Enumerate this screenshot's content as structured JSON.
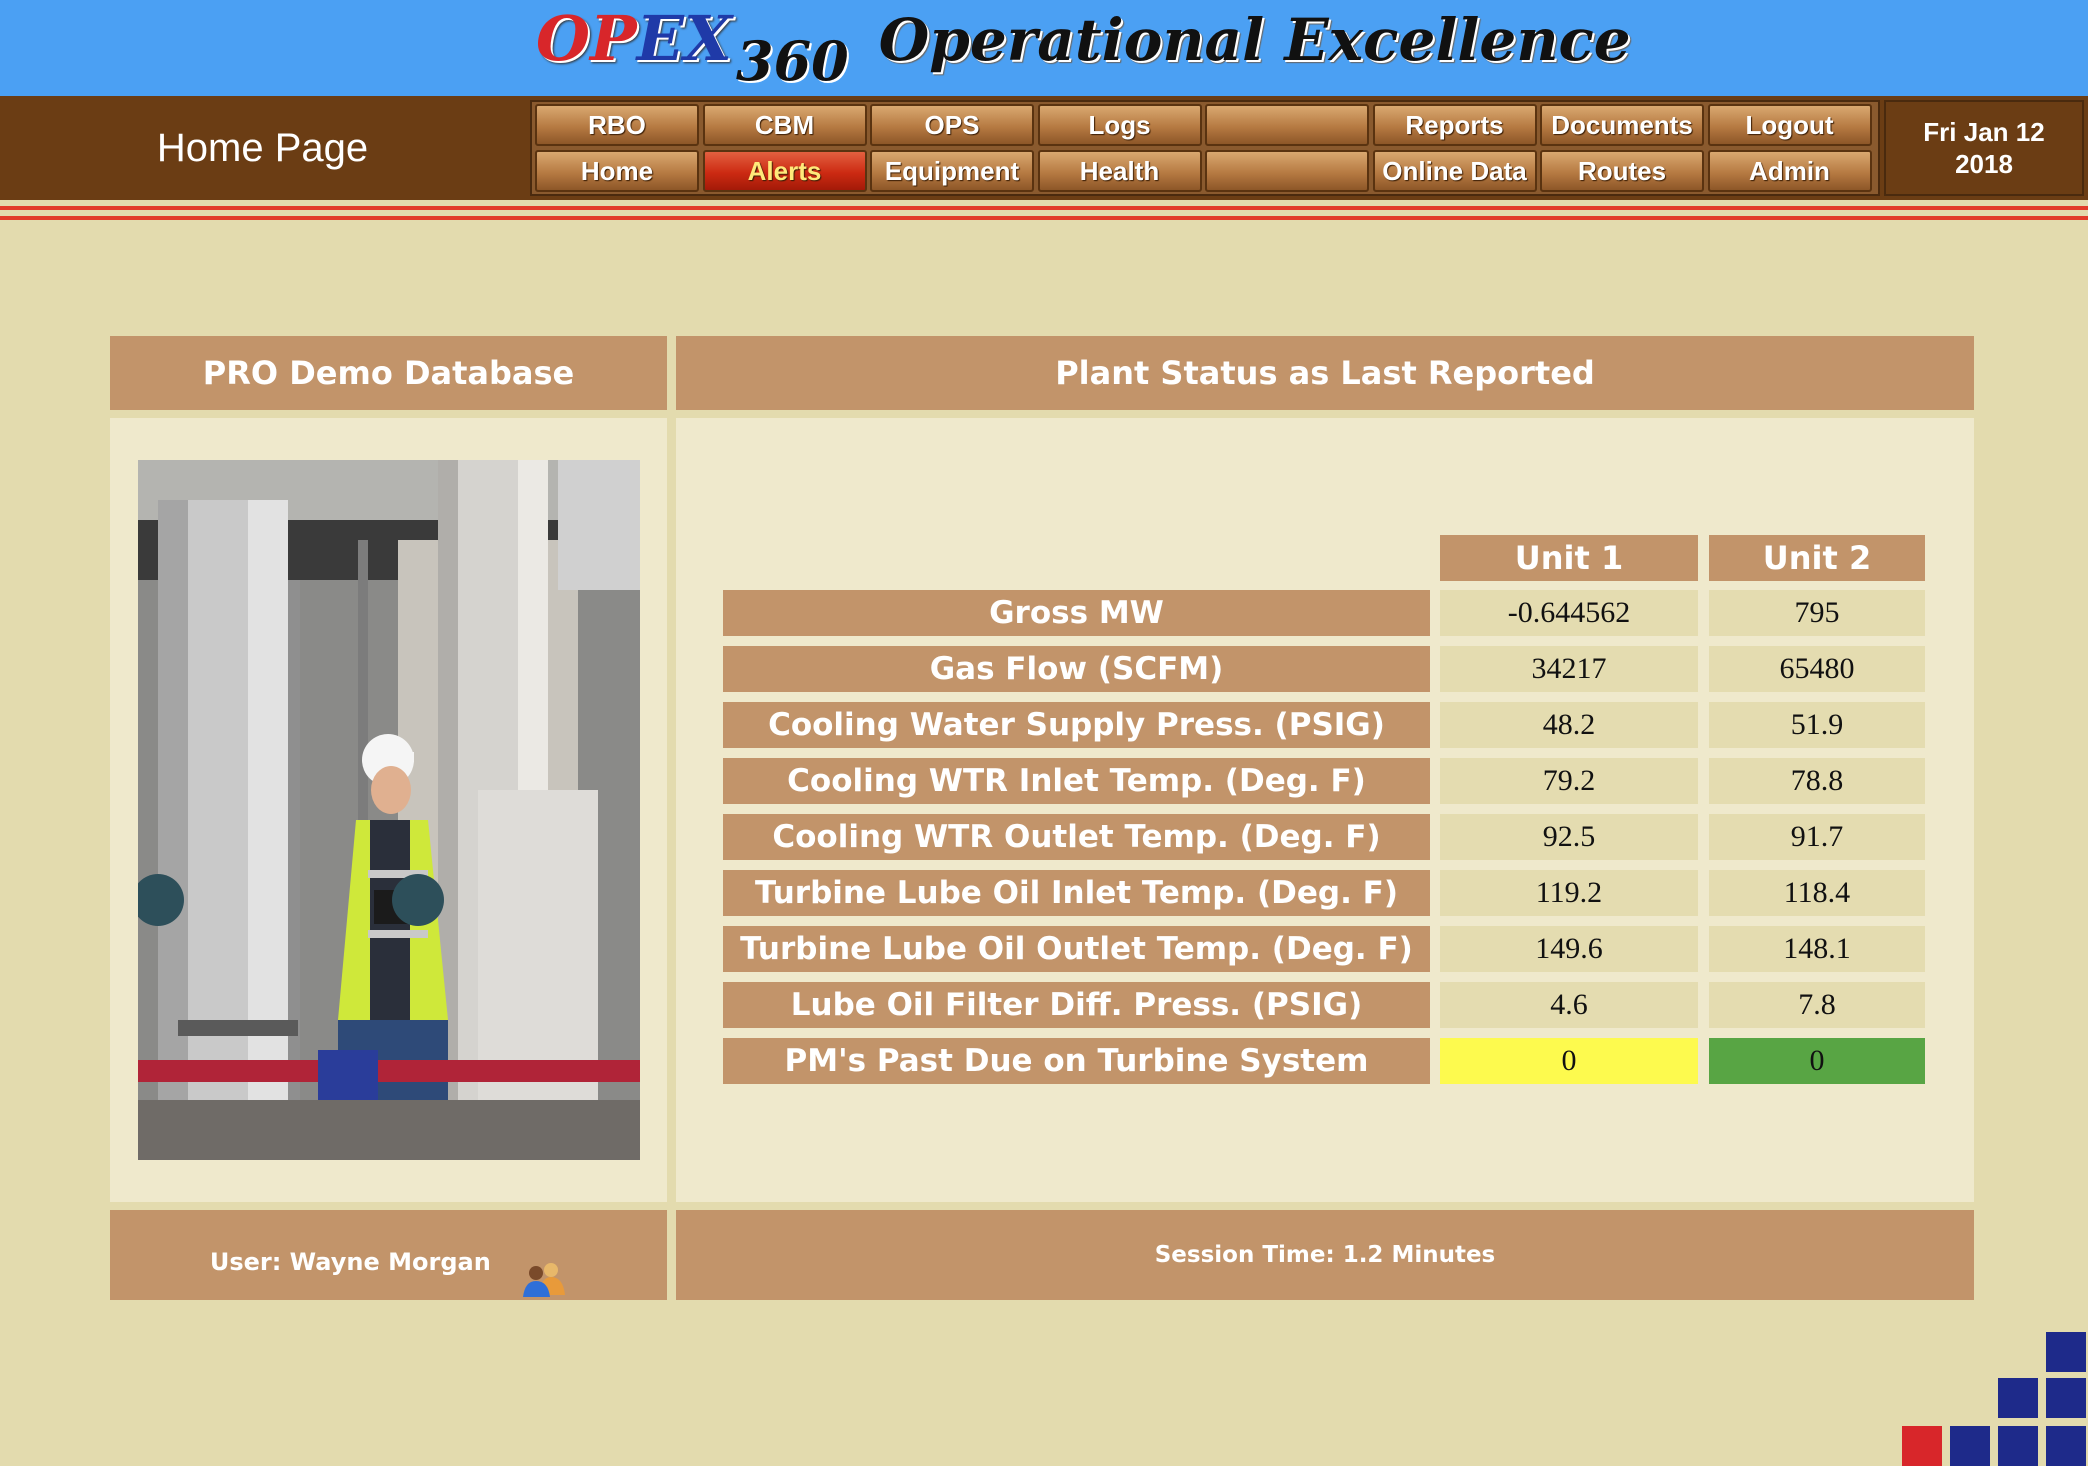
{
  "brand": {
    "logo_op": "OP",
    "logo_ex": "EX",
    "logo_360": "360",
    "title": "Operational Excellence"
  },
  "header": {
    "page_label": "Home Page",
    "date_line1": "Fri Jan 12",
    "date_line2": "2018"
  },
  "nav": {
    "top_row": [
      "RBO",
      "CBM",
      "OPS",
      "Logs",
      "",
      "Reports",
      "Documents",
      "Logout"
    ],
    "bottom_row": [
      "Home",
      "Alerts",
      "Equipment",
      "Health",
      "",
      "Online Data",
      "Routes",
      "Admin"
    ],
    "active": "Alerts"
  },
  "left_panel": {
    "title": "PRO Demo Database",
    "user_text": "User: Wayne Morgan"
  },
  "right_panel": {
    "title": "Plant Status as Last Reported",
    "session_text": "Session Time: 1.2 Minutes"
  },
  "status_table": {
    "columns": [
      "Unit 1",
      "Unit 2"
    ],
    "rows": [
      {
        "label": "Gross MW",
        "unit1": "-0.644562",
        "unit2": "795"
      },
      {
        "label": "Gas Flow (SCFM)",
        "unit1": "34217",
        "unit2": "65480"
      },
      {
        "label": "Cooling Water Supply Press. (PSIG)",
        "unit1": "48.2",
        "unit2": "51.9"
      },
      {
        "label": "Cooling WTR Inlet Temp. (Deg. F)",
        "unit1": "79.2",
        "unit2": "78.8"
      },
      {
        "label": "Cooling WTR Outlet Temp. (Deg. F)",
        "unit1": "92.5",
        "unit2": "91.7"
      },
      {
        "label": "Turbine Lube Oil Inlet Temp. (Deg. F)",
        "unit1": "119.2",
        "unit2": "118.4"
      },
      {
        "label": "Turbine Lube Oil Outlet Temp. (Deg. F)",
        "unit1": "149.6",
        "unit2": "148.1"
      },
      {
        "label": "Lube Oil Filter Diff. Press. (PSIG)",
        "unit1": "4.6",
        "unit2": "7.8"
      },
      {
        "label": "PM's Past Due on Turbine System",
        "unit1": "0",
        "unit2": "0"
      }
    ],
    "pm_status_colors": {
      "unit1": "#fdfa4e",
      "unit2": "#58a544"
    }
  },
  "colors": {
    "banner": "#4ba0f3",
    "nav_bar": "#6b3d14",
    "panel_header": "#c2946a",
    "page_bg": "#e3dbae",
    "accent_red": "#e23c2a"
  },
  "icons": [
    "users-icon"
  ]
}
